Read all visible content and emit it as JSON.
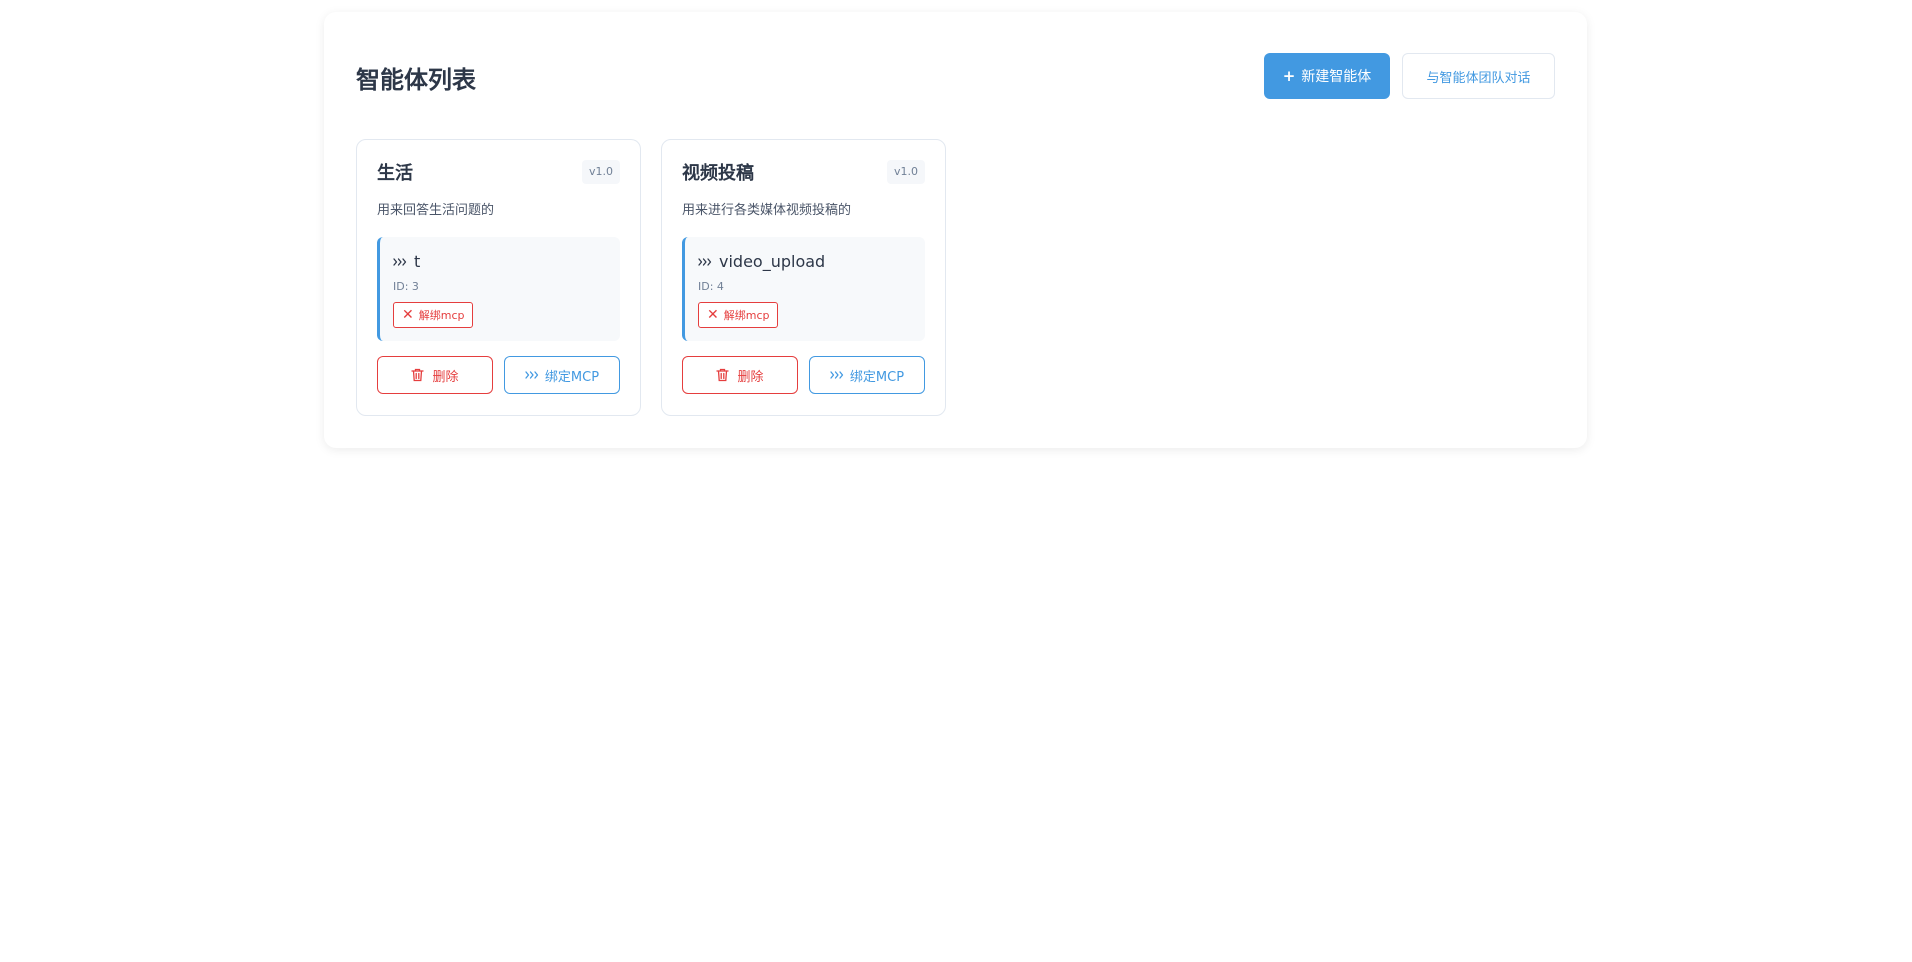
{
  "page": {
    "title": "智能体列表",
    "new_agent_label": "新建智能体",
    "new_agent_icon": "plus-icon",
    "team_chat_label": "与智能体团队对话"
  },
  "colors": {
    "primary": "#4299e1",
    "danger": "#e53e3e",
    "text": "#2d3748",
    "muted": "#718096"
  },
  "agents": [
    {
      "name": "生活",
      "version": "v1.0",
      "description": "用来回答生活问题的",
      "mcp": {
        "icon": "mcp-icon",
        "name": "t",
        "id": "ID: 3",
        "unbind_label": "解绑mcp"
      },
      "delete_label": "删除",
      "bind_label": "绑定MCP"
    },
    {
      "name": "视频投稿",
      "version": "v1.0",
      "description": "用来进行各类媒体视频投稿的",
      "mcp": {
        "icon": "mcp-icon",
        "name": "video_upload",
        "id": "ID: 4",
        "unbind_label": "解绑mcp"
      },
      "delete_label": "删除",
      "bind_label": "绑定MCP"
    }
  ]
}
